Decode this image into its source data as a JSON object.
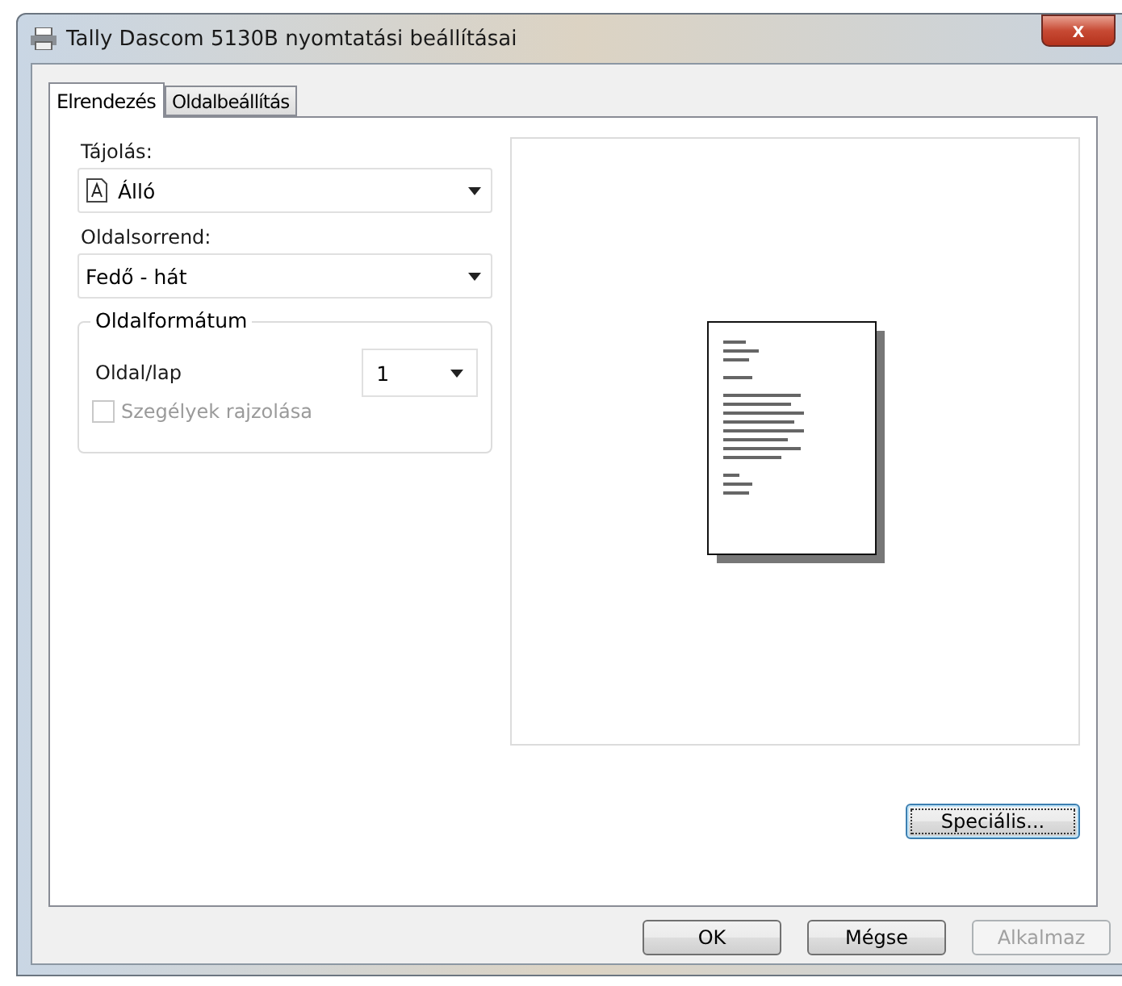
{
  "window": {
    "title": "Tally Dascom 5130B nyomtatási beállításai",
    "close": "x"
  },
  "tabs": [
    {
      "label": "Elrendezés",
      "selected": true
    },
    {
      "label": "Oldalbeállítás",
      "selected": false
    }
  ],
  "orientation": {
    "label": "Tájolás:",
    "value": "Álló"
  },
  "page_order": {
    "label": "Oldalsorrend:",
    "value": "Fedő - hát"
  },
  "page_format": {
    "title": "Oldalformátum",
    "pages_per_sheet": {
      "label": "Oldal/lap",
      "value": "1"
    },
    "draw_borders": {
      "label": "Szegélyek rajzolása",
      "checked": false,
      "disabled": true
    }
  },
  "advanced_button": {
    "label": "Speciális...",
    "focused": true
  },
  "buttons": [
    {
      "label": "OK",
      "disabled": false
    },
    {
      "label": "Mégse",
      "disabled": false
    },
    {
      "label": "Alkalmaz",
      "disabled": true
    }
  ]
}
